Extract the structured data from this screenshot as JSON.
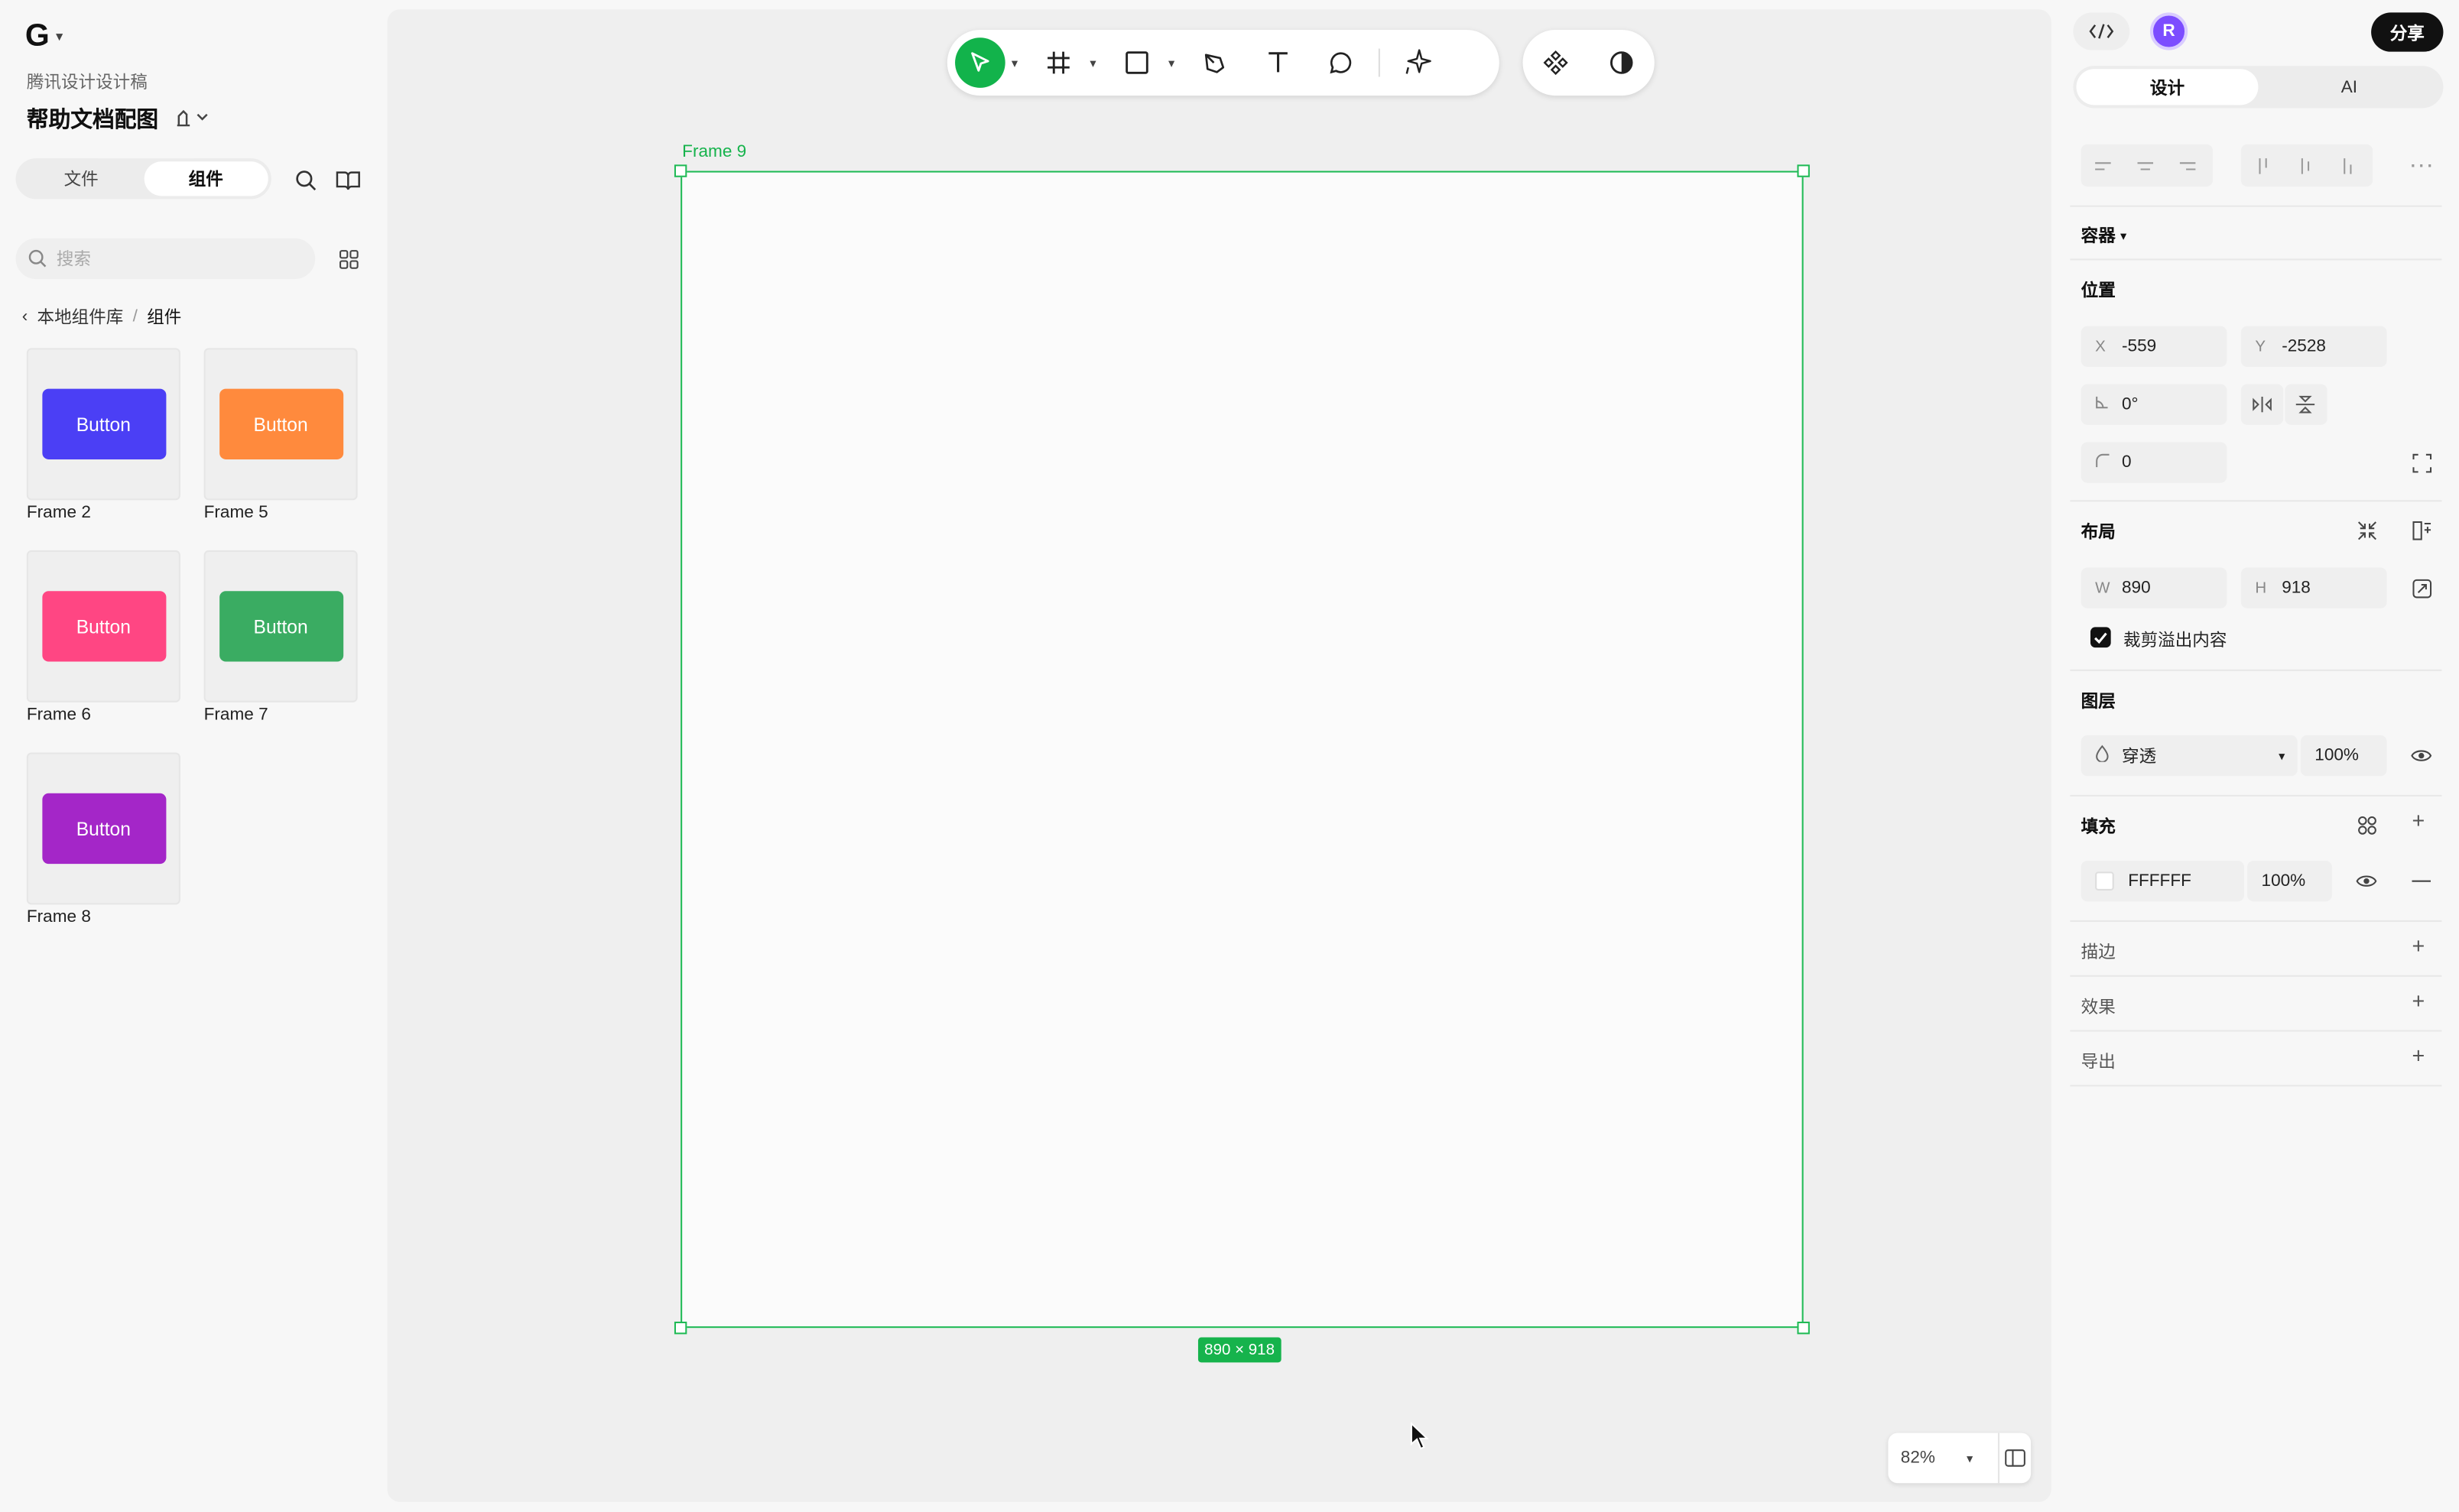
{
  "app": {
    "logo_glyph": "G",
    "team_name": "腾讯设计设计稿",
    "file_title": "帮助文档配图",
    "share_label": "分享",
    "avatar_initial": "R"
  },
  "left_tabs": {
    "files": "文件",
    "components": "组件"
  },
  "search": {
    "placeholder": "搜索"
  },
  "breadcrumb": {
    "parent": "本地组件库",
    "separator": "/",
    "current": "组件"
  },
  "components": [
    {
      "label": "Frame 2",
      "button_text": "Button",
      "color": "#4b3ff5"
    },
    {
      "label": "Frame 5",
      "button_text": "Button",
      "color": "#ff8a3d"
    },
    {
      "label": "Frame 6",
      "button_text": "Button",
      "color": "#ff4683"
    },
    {
      "label": "Frame 7",
      "button_text": "Button",
      "color": "#3aac62"
    },
    {
      "label": "Frame 8",
      "button_text": "Button",
      "color": "#a426c8"
    }
  ],
  "canvas": {
    "frame_name": "Frame 9",
    "size_badge": "890 × 918",
    "zoom": "82%",
    "accent": "#16b34c"
  },
  "right_tabs": {
    "design": "设计",
    "ai": "AI"
  },
  "panel": {
    "container_label": "容器",
    "position": {
      "title": "位置",
      "x_label": "X",
      "x": "-559",
      "y_label": "Y",
      "y": "-2528",
      "rotation": "0°",
      "radius": "0"
    },
    "layout": {
      "title": "布局",
      "w_label": "W",
      "w": "890",
      "h_label": "H",
      "h": "918",
      "clip_label": "裁剪溢出内容"
    },
    "layer": {
      "title": "图层",
      "blend": "穿透",
      "opacity": "100%"
    },
    "fill": {
      "title": "填充",
      "hex": "FFFFFF",
      "opacity": "100%"
    },
    "stroke": "描边",
    "effects": "效果",
    "export": "导出"
  }
}
